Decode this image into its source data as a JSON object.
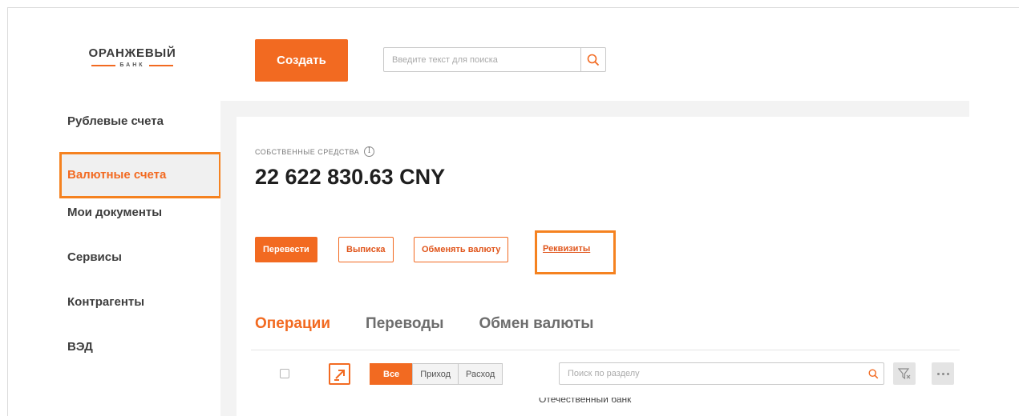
{
  "logo": {
    "top": "ОРАНЖЕВЫЙ",
    "bottom": "БАНК"
  },
  "header": {
    "create_label": "Создать",
    "search_placeholder": "Введите текст для поиска"
  },
  "sidebar": {
    "items": [
      {
        "label": "Рублевые счета"
      },
      {
        "label": "Валютные счета",
        "active": true
      },
      {
        "label": "Мои документы"
      },
      {
        "label": "Сервисы"
      },
      {
        "label": "Контрагенты"
      },
      {
        "label": "ВЭД"
      }
    ]
  },
  "account": {
    "own_funds_label": "СОБСТВЕННЫЕ СРЕДСТВА",
    "balance": "22 622 830.63 CNY"
  },
  "actions": {
    "transfer": "Перевести",
    "statement": "Выписка",
    "exchange": "Обменять валюту",
    "requisites": "Реквизиты"
  },
  "tabs": [
    {
      "label": "Операции",
      "active": true
    },
    {
      "label": "Переводы"
    },
    {
      "label": "Обмен валюты"
    }
  ],
  "filters": {
    "segments": [
      "Все",
      "Приход",
      "Расход"
    ],
    "active_segment": "Все",
    "section_search_placeholder": "Поиск по разделу"
  },
  "footer_cut_text": "Отечественный банк",
  "colors": {
    "accent": "#f26a21",
    "highlight": "#f58220"
  },
  "icons": [
    "search-icon",
    "info-icon",
    "export-icon",
    "filter-clear-icon",
    "more-icon"
  ]
}
